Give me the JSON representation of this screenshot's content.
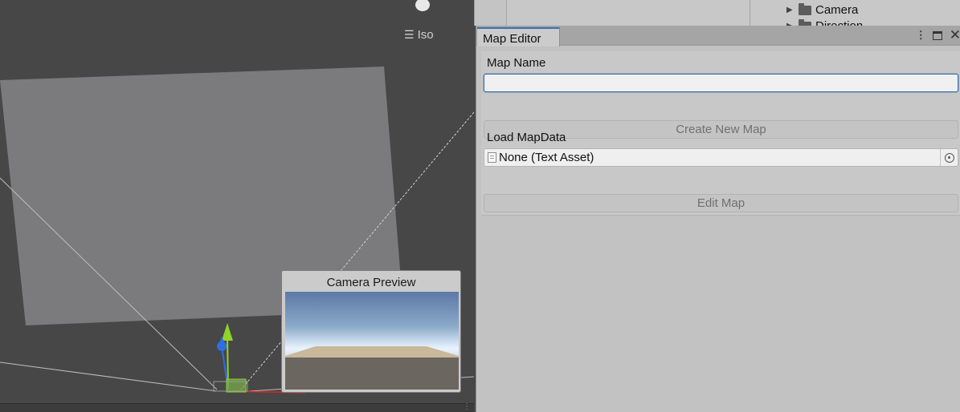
{
  "scene": {
    "iso_label": "Iso",
    "camera_preview_title": "Camera Preview"
  },
  "hierarchy": {
    "items": [
      {
        "label": "Camera",
        "icon": "folder-icon"
      },
      {
        "label": "Direction",
        "icon": "folder-icon"
      }
    ]
  },
  "map_editor": {
    "tab_title": "Map Editor",
    "map_name_label": "Map Name",
    "map_name_value": "",
    "create_button_label": "Create New Map",
    "load_label": "Load MapData",
    "load_field_value": "None (Text Asset)",
    "edit_button_label": "Edit Map",
    "accent_color": "#3a72b0"
  },
  "colors": {
    "scene_background": "#474747",
    "editor_background": "#c8c8c8",
    "gizmo_y": "#8fd42a",
    "gizmo_z": "#2f6ee0",
    "gizmo_x": "#d62a2a"
  }
}
